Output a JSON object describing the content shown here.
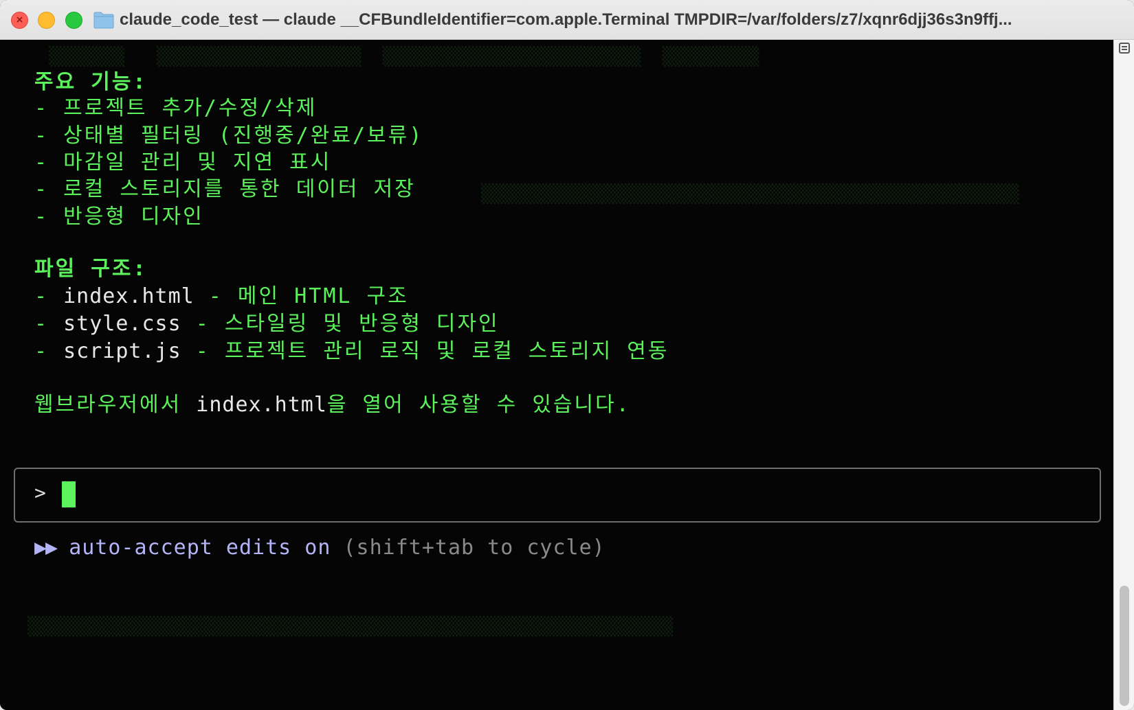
{
  "window": {
    "title": "claude_code_test — claude __CFBundleIdentifier=com.apple.Terminal TMPDIR=/var/folders/z7/xqnr6djj36s3n9ffj..."
  },
  "terminal": {
    "features_heading": "주요 기능:",
    "features": [
      "- 프로젝트 추가/수정/삭제",
      "- 상태별 필터링 (진행중/완료/보류)",
      "- 마감일 관리 및 지연 표시",
      "- 로컬 스토리지를 통한 데이터 저장",
      "- 반응형 디자인"
    ],
    "structure_heading": "파일 구조:",
    "files": [
      {
        "prefix": "- ",
        "name": "index.html",
        "desc": " - 메인 HTML 구조"
      },
      {
        "prefix": "- ",
        "name": "style.css",
        "desc": " - 스타일링 및 반응형 디자인"
      },
      {
        "prefix": "- ",
        "name": "script.js",
        "desc": " - 프로젝트 관리 로직 및 로컬 스토리지 연동"
      }
    ],
    "closing": {
      "before": "웹브라우저에서 ",
      "name": "index.html",
      "after": "을 열어 사용할 수 있습니다."
    }
  },
  "prompt": {
    "caret": ">"
  },
  "mode": {
    "icon": "▶▶",
    "label": "auto-accept edits on",
    "hint": "(shift+tab to cycle)"
  },
  "colors": {
    "output_green": "#5cf25c",
    "filename_white": "#e8e8e8",
    "mode_purple": "#b4b4f8",
    "hint_gray": "#8a8a8a"
  }
}
